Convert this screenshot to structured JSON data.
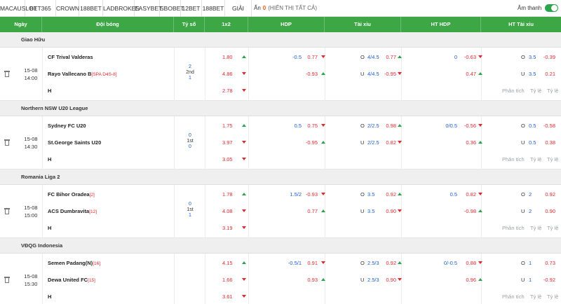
{
  "topbar": {
    "tabs": [
      "MACAUSLOT",
      "BET365",
      "CROWN",
      "188BET",
      "LADBROKES",
      "EASYBET",
      "SBOBET",
      "12BET",
      "188BET",
      "GIẢI ĐẤU"
    ],
    "hide_label": "Ẩn",
    "hide_count": "0",
    "show_all": "(HIỂN THỊ TẤT CẢ)",
    "sound_label": "Âm thanh",
    "sound_on": true
  },
  "header": {
    "date": "Ngày",
    "teams": "Đội bóng",
    "score": "Tỷ số",
    "x12": "1x2",
    "hdp": "HDP",
    "ou": "Tài xỉu",
    "ht_hdp": "HT HDP",
    "ht_ou": "HT Tài xỉu"
  },
  "links": {
    "analysis": "Phân tích",
    "odds": "Tỷ lệ"
  },
  "colors": {
    "header_green": "#3da746",
    "odds_red": "#e0282e",
    "line_blue": "#1a5fd0"
  },
  "leagues": [
    {
      "name": "Giao Hữu",
      "match": {
        "date": "15-08",
        "time": "14:00",
        "home": "CF Trival Valderas",
        "home_rank": "",
        "away": "Rayo Vallecano B",
        "away_rank": "[SPA D4S-8]",
        "score_home": "2",
        "period": "2nd",
        "score_away": "1",
        "x12": [
          "1.80",
          "4.86",
          "2.78"
        ],
        "hdp_line_home": "-0.5",
        "hdp_odd_home": "0.77",
        "hdp_line_away": "",
        "hdp_odd_away": "-0.93",
        "ou_o": "O",
        "ou_line_o": "4/4.5",
        "ou_odd_o": "0.77",
        "ou_u": "U",
        "ou_line_u": "4/4.5",
        "ou_odd_u": "-0.95",
        "hthdp_line": "0",
        "hthdp_odd_home": "-0.63",
        "hthdp_odd_away": "0.47",
        "htou_o": "O",
        "htou_line_o": "3.5",
        "htou_odd_o": "-0.39",
        "htou_u": "U",
        "htou_line_u": "3.5",
        "htou_odd_u": "0.21",
        "draw": "H"
      }
    },
    {
      "name": "Northern NSW U20 League",
      "match": {
        "date": "15-08",
        "time": "14:30",
        "home": "Sydney FC U20",
        "home_rank": "",
        "away": "St.George Saints U20",
        "away_rank": "",
        "score_home": "0",
        "period": "1st",
        "score_away": "0",
        "x12": [
          "1.75",
          "3.97",
          "3.05"
        ],
        "hdp_line_home": "0.5",
        "hdp_odd_home": "0.75",
        "hdp_line_away": "",
        "hdp_odd_away": "-0.95",
        "ou_o": "O",
        "ou_line_o": "2/2.5",
        "ou_odd_o": "0.98",
        "ou_u": "U",
        "ou_line_u": "2/2.5",
        "ou_odd_u": "0.82",
        "hthdp_line": "0/0.5",
        "hthdp_odd_home": "-0.56",
        "hthdp_odd_away": "0.36",
        "htou_o": "O",
        "htou_line_o": "0.5",
        "htou_odd_o": "-0.58",
        "htou_u": "U",
        "htou_line_u": "0.5",
        "htou_odd_u": "0.38",
        "draw": "H"
      }
    },
    {
      "name": "Romania Liga 2",
      "match": {
        "date": "15-08",
        "time": "15:00",
        "home": "FC Bihor Oradea",
        "home_rank": "[2]",
        "away": "ACS Dumbravita",
        "away_rank": "[12]",
        "score_home": "0",
        "period": "1st",
        "score_away": "1",
        "x12": [
          "1.78",
          "4.08",
          "3.19"
        ],
        "hdp_line_home": "1.5/2",
        "hdp_odd_home": "-0.93",
        "hdp_line_away": "",
        "hdp_odd_away": "0.77",
        "ou_o": "O",
        "ou_line_o": "3.5",
        "ou_odd_o": "0.92",
        "ou_u": "U",
        "ou_line_u": "3.5",
        "ou_odd_u": "0.90",
        "hthdp_line": "0.5",
        "hthdp_odd_home": "0.82",
        "hthdp_odd_away": "-0.98",
        "htou_o": "O",
        "htou_line_o": "2",
        "htou_odd_o": "0.92",
        "htou_u": "U",
        "htou_line_u": "2",
        "htou_odd_u": "0.90",
        "draw": "H"
      }
    },
    {
      "name": "VĐQG Indonesia",
      "match": {
        "date": "15-08",
        "time": "15:30",
        "home": "Semen Padang(N)",
        "home_rank": "[16]",
        "away": "Dewa United FC",
        "away_rank": "[15]",
        "score_home": "",
        "period": "",
        "score_away": "",
        "x12": [
          "4.15",
          "1.66",
          "3.61"
        ],
        "hdp_line_home": "-0.5/1",
        "hdp_odd_home": "0.91",
        "hdp_line_away": "",
        "hdp_odd_away": "0.93",
        "ou_o": "O",
        "ou_line_o": "2.5/3",
        "ou_odd_o": "0.92",
        "ou_u": "U",
        "ou_line_u": "2.5/3",
        "ou_odd_u": "0.90",
        "hthdp_line": "0/-0.5",
        "hthdp_odd_home": "0.88",
        "hthdp_odd_away": "0.96",
        "htou_o": "O",
        "htou_line_o": "1",
        "htou_odd_o": "0.73",
        "htou_u": "U",
        "htou_line_u": "1",
        "htou_odd_u": "-0.92",
        "draw": "H"
      }
    }
  ]
}
